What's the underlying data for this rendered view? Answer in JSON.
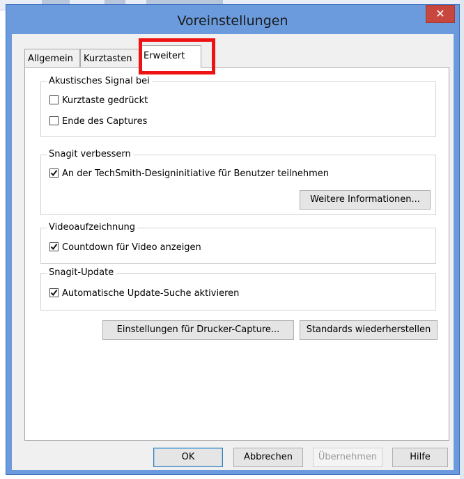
{
  "window": {
    "title": "Voreinstellungen",
    "close_symbol": "✕"
  },
  "tabs": [
    {
      "label": "Allgemein",
      "active": false
    },
    {
      "label": "Kurztasten",
      "active": false
    },
    {
      "label": "Erweitert",
      "active": true
    }
  ],
  "groups": {
    "signal": {
      "label": "Akustisches Signal bei",
      "items": [
        {
          "label": "Kurztaste gedrückt",
          "checked": false
        },
        {
          "label": "Ende des Captures",
          "checked": false
        }
      ]
    },
    "improve": {
      "label": "Snagit verbessern",
      "items": [
        {
          "label": "An der TechSmith-Designinitiative für Benutzer teilnehmen",
          "checked": true
        }
      ],
      "button": "Weitere Informationen..."
    },
    "video": {
      "label": "Videoaufzeichnung",
      "items": [
        {
          "label": "Countdown für Video anzeigen",
          "checked": true
        }
      ]
    },
    "update": {
      "label": "Snagit-Update",
      "items": [
        {
          "label": "Automatische Update-Suche aktivieren",
          "checked": true
        }
      ]
    }
  },
  "panel_buttons": {
    "printer": "Einstellungen für Drucker-Capture...",
    "defaults": "Standards wiederherstellen"
  },
  "footer_buttons": {
    "ok": "OK",
    "cancel": "Abbrechen",
    "apply": "Übernehmen",
    "help": "Hilfe"
  },
  "colors": {
    "titlebar": "#6b9bdd",
    "close": "#c7473f",
    "highlight": "#ef1212"
  }
}
